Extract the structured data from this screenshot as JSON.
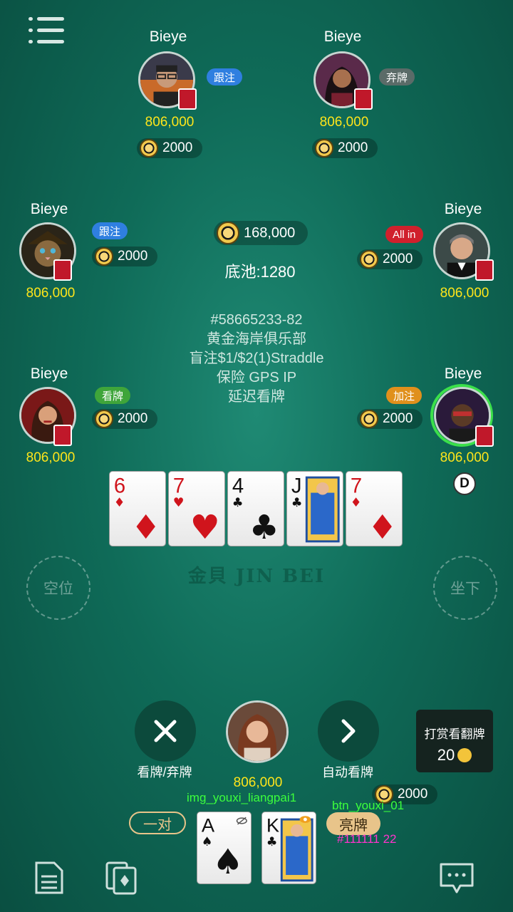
{
  "players": {
    "top_left": {
      "name": "Bieye",
      "stack": "806,000",
      "bet": "2000",
      "action": "跟注"
    },
    "top_right": {
      "name": "Bieye",
      "stack": "806,000",
      "bet": "2000",
      "action": "弃牌"
    },
    "mid_left": {
      "name": "Bieye",
      "stack": "806,000",
      "bet": "2000",
      "action": "跟注"
    },
    "mid_right": {
      "name": "Bieye",
      "stack": "806,000",
      "bet": "2000",
      "action": "All in"
    },
    "low_left": {
      "name": "Bieye",
      "stack": "806,000",
      "bet": "2000",
      "action": "看牌"
    },
    "low_right": {
      "name": "Bieye",
      "stack": "806,000",
      "bet": "2000",
      "action": "加注",
      "dealer_badge": "D"
    },
    "hero": {
      "stack": "806,000",
      "bet": "2000"
    }
  },
  "pot": {
    "amount": "168,000",
    "base": "底池:1280"
  },
  "table_info": [
    "#58665233-82",
    "黄金海岸俱乐部",
    "盲注$1/$2(1)Straddle",
    "保险 GPS IP",
    "延迟看牌"
  ],
  "watermark": "金貝 JIN BEI",
  "board": [
    {
      "rank": "6",
      "suit": "♦",
      "color": "#d0141c"
    },
    {
      "rank": "7",
      "suit": "♥",
      "color": "#d0141c"
    },
    {
      "rank": "4",
      "suit": "♣",
      "color": "#111111"
    },
    {
      "rank": "J",
      "suit": "♣",
      "color": "#111111"
    },
    {
      "rank": "7",
      "suit": "♦",
      "color": "#d0141c"
    }
  ],
  "empty_seats": {
    "left": "空位",
    "right": "坐下"
  },
  "actions": {
    "fold_label": "看牌/弃牌",
    "auto_label": "自动看牌"
  },
  "tip_box": {
    "title": "打赏看翻牌",
    "amount": "20"
  },
  "hand_rank": "一对",
  "hole_cards": [
    {
      "rank": "A",
      "suit": "♠",
      "color": "#111111"
    },
    {
      "rank": "K",
      "suit": "♣",
      "color": "#111111"
    }
  ],
  "show_button": "亮牌",
  "debug": {
    "img_label": "img_youxi_liangpai1",
    "btn_label": "btn_youxi_01",
    "color_code": "#111111  22"
  },
  "colors": {
    "table": "#0f6b58",
    "stack": "#ffe51a",
    "tag_blue": "#2f7fe0",
    "tag_grey": "#5b6b68",
    "tag_red": "#d0202c",
    "tag_green": "#3fa53a",
    "tag_orange": "#e0901c",
    "show_btn": "#e8c48a"
  }
}
